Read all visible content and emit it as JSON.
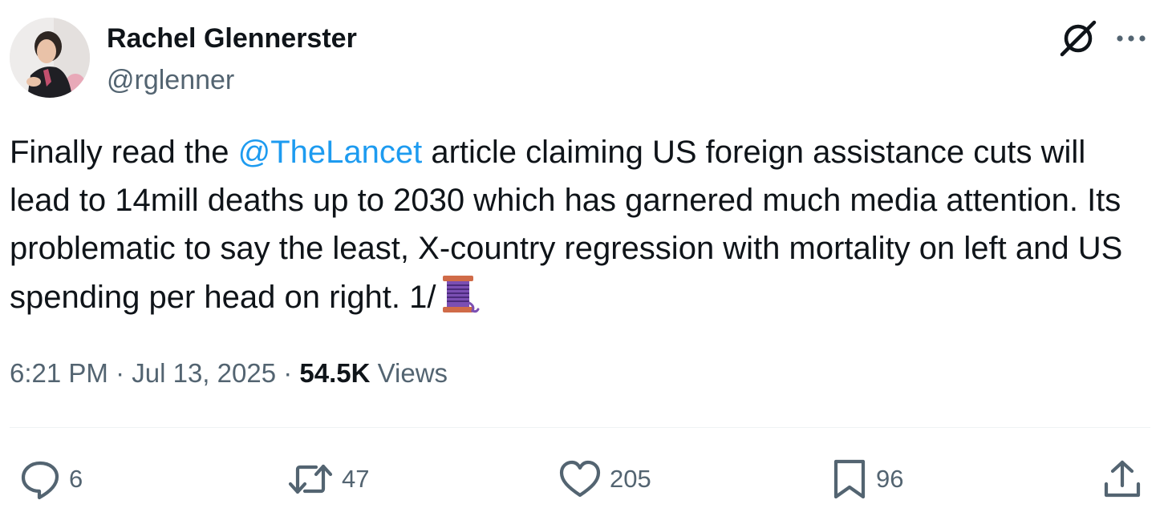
{
  "author": {
    "display_name": "Rachel Glennerster",
    "handle": "@rglenner"
  },
  "tweet": {
    "text_before_mention": "Finally read the ",
    "mention": "@TheLancet",
    "text_after_mention": " article claiming US foreign assistance cuts will lead to 14mill deaths up to 2030 which has garnered much media attention.  Its problematic to say the least, X-country regression with mortality on left and US spending per head on right. 1/",
    "thread_emoji": "spool-of-thread-icon"
  },
  "meta": {
    "time": "6:21 PM",
    "separator1": " · ",
    "date": "Jul 13, 2025",
    "separator2": " · ",
    "views_count": "54.5K",
    "views_label": " Views"
  },
  "actions": {
    "replies": "6",
    "reposts": "47",
    "likes": "205",
    "bookmarks": "96"
  },
  "icons": {
    "header_right": [
      "grok-icon",
      "more-options-icon"
    ],
    "action_bar": [
      "reply-icon",
      "repost-icon",
      "like-icon",
      "bookmark-icon",
      "share-icon"
    ]
  },
  "colors": {
    "text_primary": "#0f1419",
    "text_secondary": "#536471",
    "link": "#1d9bf0",
    "divider": "#eff3f4",
    "background": "#ffffff"
  }
}
